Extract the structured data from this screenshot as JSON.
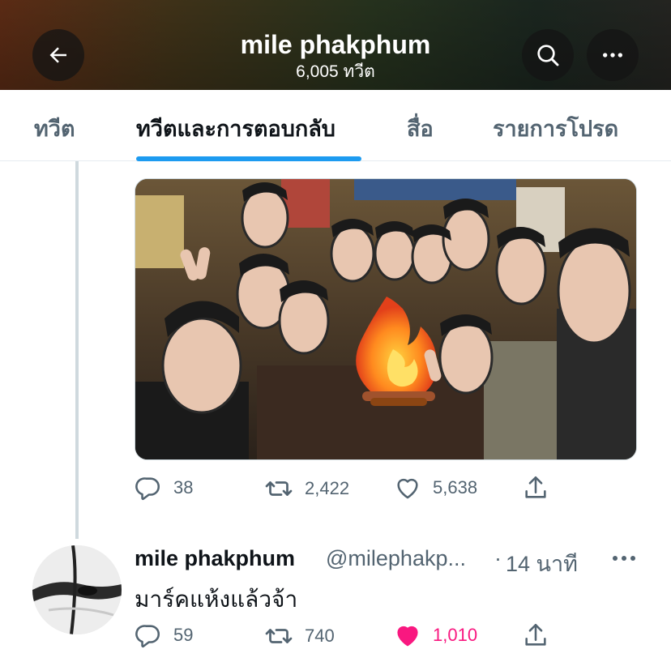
{
  "header": {
    "title": "mile phakphum",
    "subtitle": "6,005 ทวีต",
    "back_icon": "arrow-left-icon",
    "search_icon": "search-icon",
    "more_icon": "more-horizontal-icon"
  },
  "tabs": [
    {
      "label": "ทวีต",
      "active": false
    },
    {
      "label": "ทวีตและการตอบกลับ",
      "active": true
    },
    {
      "label": "สื่อ",
      "active": false
    },
    {
      "label": "รายการโปรด",
      "active": false
    }
  ],
  "colors": {
    "accent": "#1d9bf0",
    "like_active": "#f91880",
    "secondary_text": "#536471"
  },
  "tweet1": {
    "media_icon": "photo",
    "replies": "38",
    "retweets": "2,422",
    "likes": "5,638",
    "liked": false
  },
  "tweet2": {
    "name": "mile phakphum",
    "handle": "@milephakp...",
    "dot": "·",
    "time": "14 นาที",
    "text": "มาร์คแห้งแล้วจ้า",
    "replies": "59",
    "retweets": "740",
    "likes": "1,010",
    "liked": true
  }
}
